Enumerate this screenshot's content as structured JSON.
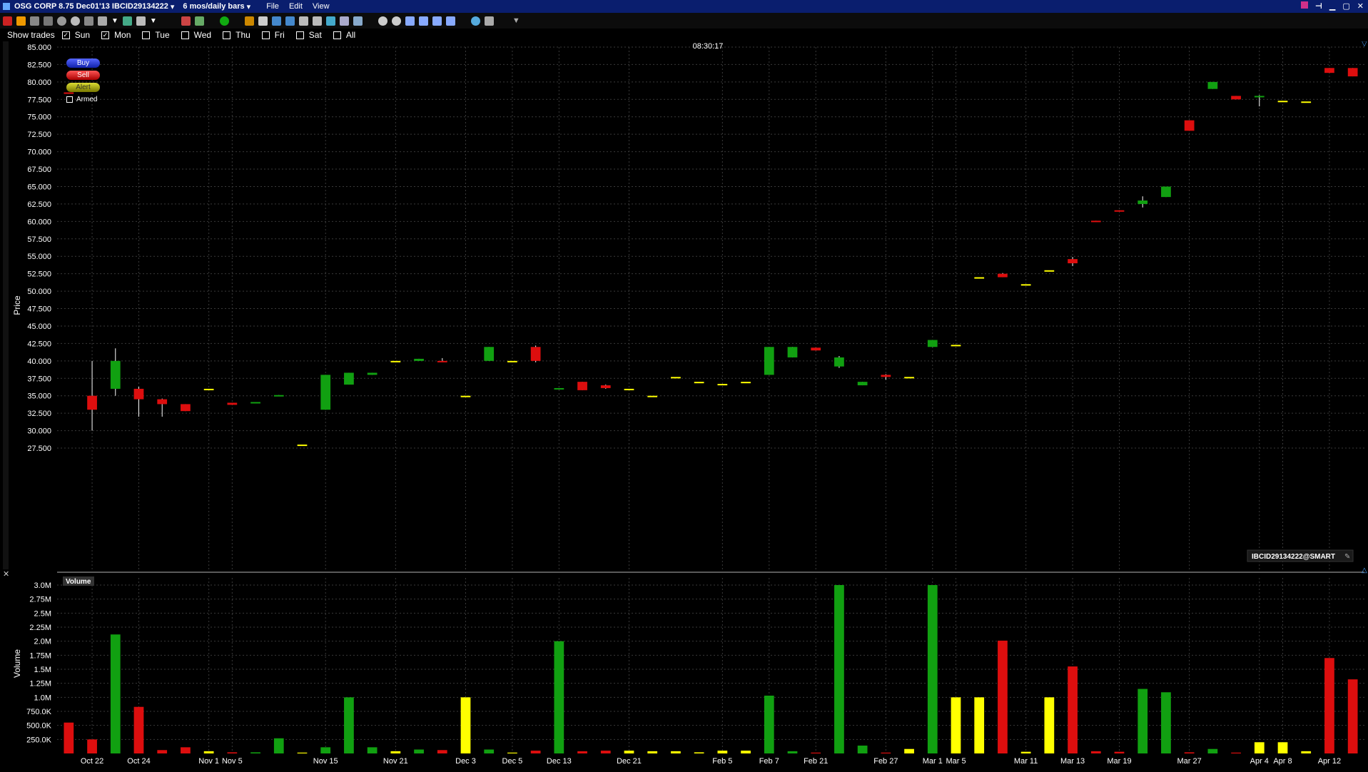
{
  "window": {
    "title": "OSG CORP 8.75 Dec01'13 IBCID29134222",
    "period": "6 mos/daily bars",
    "menus": [
      "File",
      "Edit",
      "View"
    ]
  },
  "filters": {
    "show_trades_label": "Show trades",
    "days": [
      {
        "label": "Sun",
        "checked": true
      },
      {
        "label": "Mon",
        "checked": true
      },
      {
        "label": "Tue",
        "checked": false
      },
      {
        "label": "Wed",
        "checked": false
      },
      {
        "label": "Thu",
        "checked": false
      },
      {
        "label": "Fri",
        "checked": false
      },
      {
        "label": "Sat",
        "checked": false
      },
      {
        "label": "All",
        "checked": false
      }
    ]
  },
  "panel": {
    "buy_label": "Buy",
    "sell_label": "Sell",
    "alert_label": "Alert",
    "armed_label": "Armed",
    "timestamp": "08:30:17",
    "contract_tag": "IBCID29134222@SMART",
    "volume_title": "Volume"
  },
  "colors": {
    "up": "#11a011",
    "down": "#dd0e0e",
    "flat": "#ffff00",
    "buy": "#2233dd",
    "sell": "#dd1111",
    "alert": "#aaaa00",
    "titlebar": "#0a1e6e",
    "grid": "#3a3a3a",
    "axis_text": "#ffffff"
  },
  "chart_data": [
    {
      "type": "candlestick",
      "ylabel": "Price",
      "ylim": [
        25,
        87.5
      ],
      "yticks": [
        "85.000",
        "82.500",
        "80.000",
        "77.500",
        "75.000",
        "72.500",
        "70.000",
        "67.500",
        "65.000",
        "62.500",
        "60.000",
        "57.500",
        "55.000",
        "52.500",
        "50.000",
        "47.500",
        "45.000",
        "42.500",
        "40.000",
        "37.500",
        "35.000",
        "32.500",
        "30.000",
        "27.500"
      ],
      "xticks": [
        "Oct 22",
        "Oct 24",
        "Nov 1",
        "Nov 5",
        "Nov 15",
        "Nov 21",
        "Dec 3",
        "Dec 5",
        "Dec 13",
        "Dec 21",
        "Feb 5",
        "Feb 7",
        "Feb 21",
        "Feb 27",
        "Mar 1",
        "Mar 5",
        "Mar 11",
        "Mar 13",
        "Mar 19",
        "Mar 27",
        "Apr 4",
        "Apr 8",
        "Apr 12"
      ],
      "grid": true,
      "bars": [
        {
          "o": 78.5,
          "h": 78.5,
          "l": 78.5,
          "c": 78.3
        },
        {
          "o": 35.0,
          "h": 40.0,
          "l": 30.0,
          "c": 33.0
        },
        {
          "o": 36.0,
          "h": 41.8,
          "l": 35.0,
          "c": 40.0
        },
        {
          "o": 36.0,
          "h": 36.3,
          "l": 32.0,
          "c": 34.5
        },
        {
          "o": 34.5,
          "h": 34.6,
          "l": 32.0,
          "c": 33.8
        },
        {
          "o": 33.8,
          "h": 33.8,
          "l": 32.8,
          "c": 32.8
        },
        {
          "o": 36.0,
          "h": 36.0,
          "l": 36.0,
          "c": 36.0
        },
        {
          "o": 34.0,
          "h": 34.0,
          "l": 33.7,
          "c": 33.7
        },
        {
          "o": 34.0,
          "h": 34.1,
          "l": 34.0,
          "c": 34.1
        },
        {
          "o": 35.0,
          "h": 35.1,
          "l": 35.0,
          "c": 35.1
        },
        {
          "o": 28.0,
          "h": 28.0,
          "l": 28.0,
          "c": 28.0
        },
        {
          "o": 33.0,
          "h": 38.0,
          "l": 33.0,
          "c": 38.0
        },
        {
          "o": 36.6,
          "h": 38.3,
          "l": 36.6,
          "c": 38.3
        },
        {
          "o": 38.0,
          "h": 38.3,
          "l": 38.0,
          "c": 38.3
        },
        {
          "o": 40.0,
          "h": 40.0,
          "l": 40.0,
          "c": 40.0
        },
        {
          "o": 40.0,
          "h": 40.3,
          "l": 40.0,
          "c": 40.3
        },
        {
          "o": 40.0,
          "h": 40.4,
          "l": 40.0,
          "c": 39.9
        },
        {
          "o": 35.0,
          "h": 35.0,
          "l": 35.0,
          "c": 35.0
        },
        {
          "o": 40.0,
          "h": 42.0,
          "l": 40.0,
          "c": 42.0
        },
        {
          "o": 40.0,
          "h": 40.0,
          "l": 40.0,
          "c": 40.0
        },
        {
          "o": 42.0,
          "h": 42.2,
          "l": 39.8,
          "c": 40.0
        },
        {
          "o": 36.0,
          "h": 36.1,
          "l": 36.0,
          "c": 36.1
        },
        {
          "o": 37.0,
          "h": 37.0,
          "l": 35.8,
          "c": 35.8
        },
        {
          "o": 36.5,
          "h": 36.6,
          "l": 36.0,
          "c": 36.1
        },
        {
          "o": 36.0,
          "h": 36.0,
          "l": 36.0,
          "c": 36.0
        },
        {
          "o": 35.0,
          "h": 35.0,
          "l": 35.0,
          "c": 35.0
        },
        {
          "o": 37.7,
          "h": 37.7,
          "l": 37.7,
          "c": 37.7
        },
        {
          "o": 37.0,
          "h": 37.0,
          "l": 37.0,
          "c": 37.0
        },
        {
          "o": 36.7,
          "h": 36.7,
          "l": 36.7,
          "c": 36.7
        },
        {
          "o": 37.0,
          "h": 37.0,
          "l": 37.0,
          "c": 37.0
        },
        {
          "o": 38.0,
          "h": 42.0,
          "l": 38.0,
          "c": 42.0
        },
        {
          "o": 40.5,
          "h": 42.0,
          "l": 40.5,
          "c": 42.0
        },
        {
          "o": 41.9,
          "h": 41.9,
          "l": 41.5,
          "c": 41.5
        },
        {
          "o": 39.2,
          "h": 40.7,
          "l": 39.0,
          "c": 40.5
        },
        {
          "o": 36.5,
          "h": 37.0,
          "l": 36.5,
          "c": 37.0
        },
        {
          "o": 38.0,
          "h": 38.1,
          "l": 37.3,
          "c": 37.7
        },
        {
          "o": 37.7,
          "h": 37.7,
          "l": 37.7,
          "c": 37.7
        },
        {
          "o": 42.0,
          "h": 43.0,
          "l": 42.0,
          "c": 43.0
        },
        {
          "o": 42.3,
          "h": 42.3,
          "l": 42.3,
          "c": 42.3
        },
        {
          "o": 52.0,
          "h": 52.0,
          "l": 52.0,
          "c": 52.0
        },
        {
          "o": 52.5,
          "h": 52.6,
          "l": 52.0,
          "c": 52.0
        },
        {
          "o": 51.0,
          "h": 51.0,
          "l": 51.0,
          "c": 51.0
        },
        {
          "o": 53.0,
          "h": 53.0,
          "l": 53.0,
          "c": 53.0
        },
        {
          "o": 54.6,
          "h": 54.9,
          "l": 53.6,
          "c": 54.0
        },
        {
          "o": 60.1,
          "h": 60.1,
          "l": 60.0,
          "c": 60.0
        },
        {
          "o": 61.6,
          "h": 61.6,
          "l": 61.5,
          "c": 61.5
        },
        {
          "o": 62.5,
          "h": 63.6,
          "l": 62.0,
          "c": 63.0
        },
        {
          "o": 63.5,
          "h": 65.0,
          "l": 63.5,
          "c": 65.0
        },
        {
          "o": 74.5,
          "h": 74.5,
          "l": 73.0,
          "c": 73.0
        },
        {
          "o": 79.0,
          "h": 80.0,
          "l": 79.0,
          "c": 80.0
        },
        {
          "o": 78.0,
          "h": 78.0,
          "l": 77.5,
          "c": 77.5
        },
        {
          "o": 78.0,
          "h": 78.1,
          "l": 76.5,
          "c": 78.0
        },
        {
          "o": 77.3,
          "h": 77.3,
          "l": 77.3,
          "c": 77.3
        },
        {
          "o": 77.2,
          "h": 77.2,
          "l": 77.2,
          "c": 77.2
        },
        {
          "o": 82.0,
          "h": 82.0,
          "l": 81.3,
          "c": 81.3
        },
        {
          "o": 82.0,
          "h": 82.0,
          "l": 80.8,
          "c": 80.8
        }
      ]
    },
    {
      "type": "bar",
      "ylabel": "Volume",
      "ylim": [
        0,
        3000000
      ],
      "yticks": [
        "3.0M",
        "2.75M",
        "2.5M",
        "2.25M",
        "2.0M",
        "1.75M",
        "1.5M",
        "1.25M",
        "1.0M",
        "750.0K",
        "500.0K",
        "250.0K"
      ],
      "values": [
        550000,
        250000,
        2120000,
        830000,
        60000,
        110000,
        40000,
        20000,
        20000,
        270000,
        15000,
        110000,
        1000000,
        110000,
        40000,
        70000,
        60000,
        1000000,
        70000,
        15000,
        50000,
        2000000,
        40000,
        50000,
        50000,
        40000,
        40000,
        20000,
        50000,
        50000,
        1030000,
        40000,
        15000,
        3000000,
        140000,
        15000,
        80000,
        3000000,
        1000000,
        1000000,
        2010000,
        30000,
        1000000,
        1550000,
        40000,
        30000,
        1150000,
        1090000,
        20000,
        80000,
        15000,
        200000,
        200000,
        40000,
        1700000,
        1320000
      ],
      "colors": [
        "down",
        "down",
        "up",
        "down",
        "down",
        "down",
        "flat",
        "down",
        "up",
        "up",
        "flat",
        "up",
        "up",
        "up",
        "flat",
        "up",
        "down",
        "flat",
        "up",
        "flat",
        "down",
        "up",
        "down",
        "down",
        "flat",
        "flat",
        "flat",
        "flat",
        "flat",
        "flat",
        "up",
        "up",
        "down",
        "up",
        "up",
        "down",
        "flat",
        "up",
        "flat",
        "flat",
        "down",
        "flat",
        "flat",
        "down",
        "down",
        "down",
        "up",
        "up",
        "down",
        "up",
        "down",
        "flat",
        "flat",
        "flat",
        "down",
        "down"
      ]
    }
  ]
}
